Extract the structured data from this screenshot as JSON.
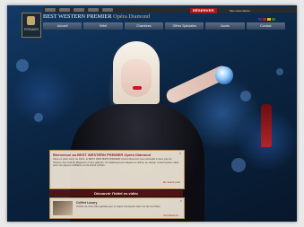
{
  "site": {
    "title_main": "BEST WESTERN PREMIER",
    "title_sub": "Opéra Diamond",
    "logo_word": "PREMIER"
  },
  "topbar": {
    "reserve_label": "RÉSERVER",
    "right_text": "Mes réservations",
    "flag_colors": [
      "#1f3f9a",
      "#c01a1a",
      "#e0c020",
      "#2a7d2a"
    ]
  },
  "nav": {
    "items": [
      "Accueil",
      "Hôtel",
      "Chambres",
      "Offres Spéciales",
      "Accès",
      "Contact"
    ]
  },
  "welcome": {
    "title": "Bienvenue au BEST WESTERN PREMIER Opéra Diamond",
    "body": "Situé en plein cœur de Paris, le BEST WESTERN PREMIER Opéra Diamond vous accueille à deux pas de l'Opéra, des Grands Magasins et des galeries. Un établissement élégant et raffiné, au design contemporain, idéal pour vos séjours d'affaires ou de loisirs à Paris.",
    "more": "En savoir plus"
  },
  "discover": {
    "title": "Découvrir l'hôtel en vidéo",
    "item_title": "Coffret Luxury",
    "item_text": "Profitez de notre offre spéciale pour un séjour d'exception dans l'un de nos hôtels.",
    "links": "Voir   Réserver"
  },
  "colors": {
    "accent_red": "#b01515",
    "panel_border": "#b78e5a",
    "nav_top": "#5a6d84",
    "background_navy": "#0b1d33"
  }
}
